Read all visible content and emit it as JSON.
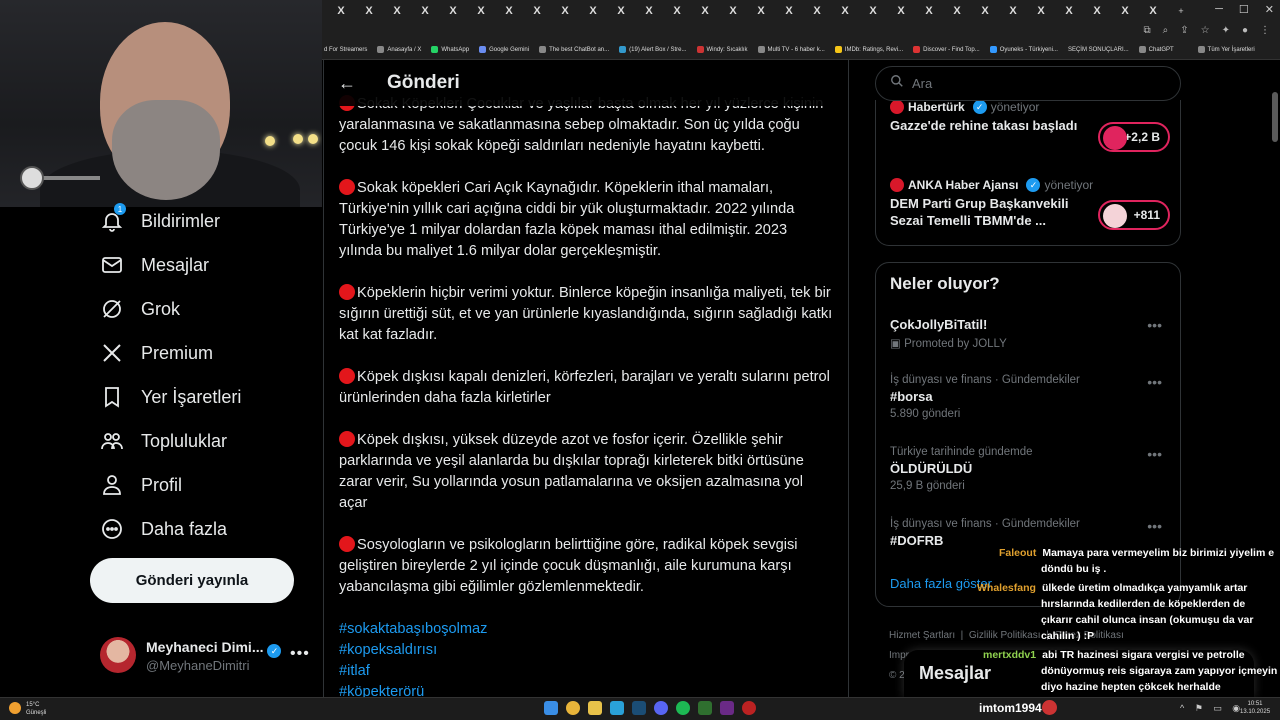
{
  "browser": {
    "tabs": [
      "X",
      "X",
      "X",
      "X",
      "X",
      "X",
      "X",
      "X",
      "X",
      "X",
      "X",
      "X",
      "X",
      "X",
      "X",
      "X",
      "X",
      "X",
      "X",
      "X",
      "X",
      "X",
      "X",
      "X",
      "X",
      "X",
      "X",
      "X",
      "X",
      "X",
      "X"
    ],
    "new_tab": "+",
    "bookmarks": [
      "d For Streamers",
      "Anasayfa / X",
      "WhatsApp",
      "Google Gemini",
      "The best ChatBot an...",
      "(19) Alert Box / Stre...",
      "Windy: Sıcaklık",
      "Multi TV - 6 haber k...",
      "IMDb: Ratings, Revi...",
      "Discover - Find Top...",
      "Oyuneks - Türkiyeni...",
      "SEÇİM SONUÇLARI...",
      "ChatGPT",
      "Tüm Yer İşaretleri"
    ]
  },
  "sidebar": {
    "items": [
      {
        "label": "Bildirimler",
        "icon": "bell-icon",
        "badge": "1"
      },
      {
        "label": "Mesajlar",
        "icon": "envelope-icon"
      },
      {
        "label": "Grok",
        "icon": "grok-icon"
      },
      {
        "label": "Premium",
        "icon": "x-logo-icon"
      },
      {
        "label": "Yer İşaretleri",
        "icon": "bookmark-icon"
      },
      {
        "label": "Topluluklar",
        "icon": "communities-icon"
      },
      {
        "label": "Profil",
        "icon": "person-icon"
      },
      {
        "label": "Daha fazla",
        "icon": "more-circle-icon"
      }
    ],
    "post_button": "Gönderi yayınla",
    "profile": {
      "name": "Meyhaneci Dimi...",
      "handle": "@MeyhaneDimitri",
      "more": "•••"
    }
  },
  "header": {
    "title": "Gönderi",
    "back": "←"
  },
  "post": {
    "paragraphs": [
      "Sokak Köpekleri Çocuklar ve yaşlılar başta olmak her yıl yüzlerce kişinin yaralanmasına ve sakatlanmasına sebep olmaktadır. Son üç yılda çoğu çocuk 146 kişi sokak köpeği saldırıları nedeniyle hayatını kaybetti.",
      "Sokak köpekleri Cari Açık Kaynağıdır.  Köpeklerin ithal mamaları, Türkiye'nin yıllık cari açığına ciddi bir yük oluşturmaktadır. 2022 yılında Türkiye'ye 1 milyar dolardan fazla köpek maması ithal edilmiştir. 2023 yılında bu maliyet 1.6 milyar dolar gerçekleşmiştir.",
      "Köpeklerin hiçbir verimi yoktur. Binlerce köpeğin insanlığa maliyeti, tek bir sığırın ürettiği süt, et ve yan ürünlerle kıyaslandığında, sığırın sağladığı katkı kat kat fazladır.",
      "Köpek dışkısı kapalı denizleri, körfezleri, barajları ve yeraltı sularını petrol ürünlerinden daha fazla kirletirler",
      "Köpek dışkısı, yüksek düzeyde azot ve fosfor içerir. Özellikle şehir parklarında ve yeşil alanlarda bu dışkılar toprağı kirleterek bitki örtüsüne zarar verir, Su yollarında yosun patlamalarına ve oksijen azalmasına yol açar",
      "Sosyologların ve psikologların belirttiğine göre, radikal köpek sevgisi geliştiren bireylerde 2 yıl içinde çocuk düşmanlığı, aile kurumuna karşı yabancılaşma gibi eğilimler gözlemlenmektedir."
    ],
    "hashtags": [
      "#sokaktabaşıboşolmaz",
      "#kopeksaldırısı",
      "#itlaf",
      "#köpekterörü"
    ]
  },
  "search": {
    "placeholder": "Ara"
  },
  "live": [
    {
      "host": "Habertürk",
      "role": "yönetiyor",
      "title": "Gazze'de rehine takası başladı",
      "count": "+2,2 B"
    },
    {
      "host": "ANKA Haber Ajansı",
      "role": "yönetiyor",
      "title": "DEM Parti Grup Başkanvekili Sezai Temelli TBMM'de ...",
      "count": "+811"
    }
  ],
  "trends": {
    "title": "Neler oluyor?",
    "items": [
      {
        "context": "",
        "name": "ÇokJollyBiTatil!",
        "count": "Promoted by JOLLY"
      },
      {
        "context": "İş dünyası ve finans · Gündemdekiler",
        "name": "#borsa",
        "count": "5.890 gönderi"
      },
      {
        "context": "Türkiye tarihinde gündemde",
        "name": "ÖLDÜRÜLDÜ",
        "count": "25,9 B gönderi"
      },
      {
        "context": "İş dünyası ve finans · Gündemdekiler",
        "name": "#DOFRB",
        "count": ""
      }
    ],
    "show_more": "Daha fazla göster"
  },
  "footer": {
    "links": [
      "Hizmet Şartları",
      "Gizlilik Politikası",
      "Çerez Politikası",
      "Impr..."
    ],
    "copyright": "© 2..."
  },
  "messages_drawer": {
    "title": "Mesajlar"
  },
  "chat": [
    {
      "user": "Faleout",
      "text": "Mamaya para vermeyelim biz birimizi yiyelim e"
    },
    {
      "user": "",
      "text": "döndü bu iş ."
    },
    {
      "user": "Whalesfang",
      "text": "ülkede üretim olmadıkça yamyamlık artar"
    },
    {
      "user": "",
      "text": "hırslarında kedilerden de köpeklerden de"
    },
    {
      "user": "",
      "text": "çıkarır cahil olunca insan (okumuşu da var"
    },
    {
      "user": "",
      "text": "cahilin ) :P"
    },
    {
      "user": "mertxddv1",
      "text": "abi TR hazinesi sigara vergisi ve petrolle"
    },
    {
      "user": "",
      "text": "dönüyormuş reis sigaraya zam yapıyor içmeyin"
    },
    {
      "user": "",
      "text": "diyo hazine hepten çökcek herhalde"
    }
  ],
  "taskbar": {
    "weather_temp": "15°C",
    "weather_desc": "Güneşli",
    "user": "imtom1994",
    "time": "10:51",
    "date": "13.10.2025"
  },
  "colors": {
    "accent": "#1d9bf0",
    "live_pink": "#e0245e",
    "bullet_red": "#e3161b",
    "chat_user": "#e0a02e"
  }
}
